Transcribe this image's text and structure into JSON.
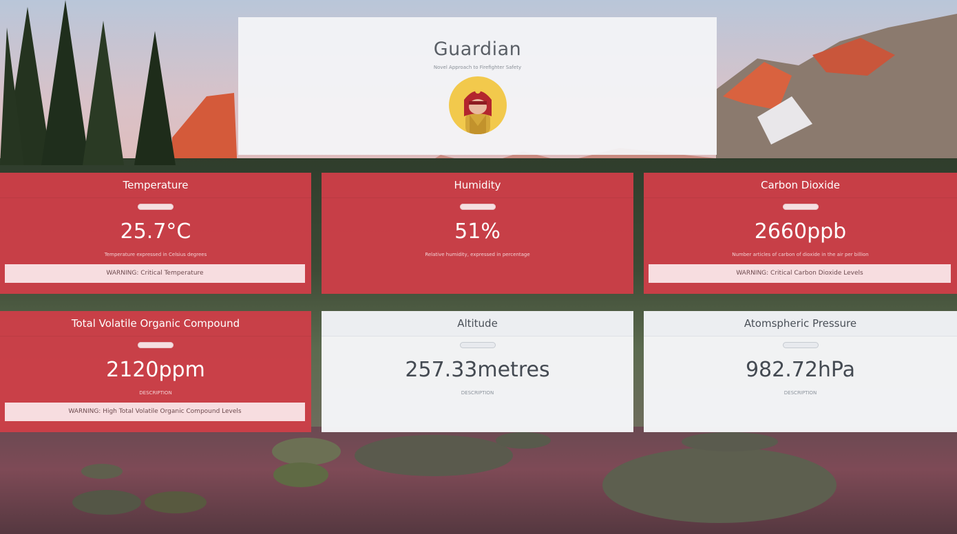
{
  "header": {
    "title": "Guardian",
    "subtitle": "Novel Approach to Firefighter Safety"
  },
  "logo": {
    "icon": "firefighter-avatar-icon",
    "colors": {
      "circle": "#f2c94c",
      "helmet": "#b3262e",
      "face": "#e9b9a0",
      "coat": "#d4a73a"
    }
  },
  "colors": {
    "alert_card": "#cd3e48",
    "normal_card": "#f6f7f9",
    "warning_bar": "#f7dde0"
  },
  "cards": [
    {
      "title": "Temperature",
      "value": "25.7°C",
      "description": "Temperature expressed in Celsius degrees",
      "warning": "WARNING: Critical Temperature",
      "status": "alert"
    },
    {
      "title": "Humidity",
      "value": "51%",
      "description": "Relative humidity, expressed in percentage",
      "status": "alert"
    },
    {
      "title": "Carbon Dioxide",
      "value": "2660ppb",
      "description": "Number articles of carbon of dioxide in the air per billion",
      "warning": "WARNING: Critical Carbon Dioxide Levels",
      "status": "alert"
    },
    {
      "title": "Total Volatile Organic Compound",
      "value": "2120ppm",
      "description": "DESCRIPTION",
      "warning": "WARNING: High Total Volatile Organic Compound Levels",
      "status": "alert"
    },
    {
      "title": "Altitude",
      "value": "257.33metres",
      "description": "DESCRIPTION",
      "status": "normal"
    },
    {
      "title": "Atomspheric Pressure",
      "value": "982.72hPa",
      "description": "DESCRIPTION",
      "status": "normal"
    }
  ]
}
